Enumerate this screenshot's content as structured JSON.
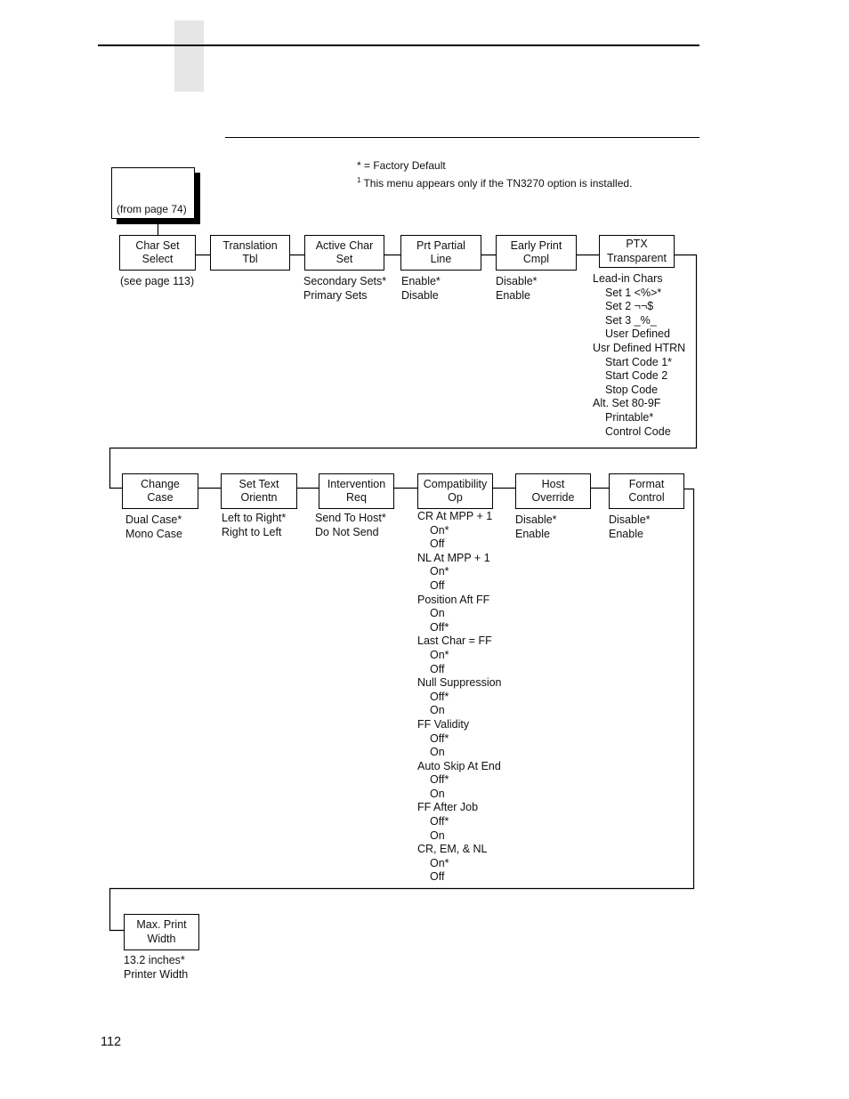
{
  "legend": {
    "default_note": "* = Factory Default",
    "footnote_mark": "1",
    "footnote_text": "This menu appears only if the TN3270 option is installed."
  },
  "entry": {
    "label": "(from page 74)"
  },
  "menus": [
    {
      "id": "char-set-select",
      "title": [
        "Char Set",
        "Select"
      ],
      "options": [
        {
          "label": "(see page 113)",
          "choices": []
        }
      ]
    },
    {
      "id": "translation-tbl",
      "title": [
        "Translation",
        "Tbl"
      ],
      "options": []
    },
    {
      "id": "active-char-set",
      "title": [
        "Active Char",
        "Set"
      ],
      "options": [
        {
          "label": "Secondary Sets*",
          "choices": []
        },
        {
          "label": "Primary Sets",
          "choices": []
        }
      ]
    },
    {
      "id": "prt-partial-line",
      "title": [
        "Prt Partial",
        "Line"
      ],
      "options": [
        {
          "label": "Enable*",
          "choices": []
        },
        {
          "label": "Disable",
          "choices": []
        }
      ]
    },
    {
      "id": "early-print-cmpl",
      "title": [
        "Early Print",
        "Cmpl"
      ],
      "options": [
        {
          "label": "Disable*",
          "choices": []
        },
        {
          "label": "Enable",
          "choices": []
        }
      ]
    },
    {
      "id": "ptx-transparent",
      "title": [
        "PTX",
        "Transparent"
      ],
      "options": [
        {
          "label": "Lead-in Chars",
          "choices": [
            "Set 1 <%>*",
            "Set 2 ¬¬$",
            "Set 3 _%_",
            "User Defined"
          ]
        },
        {
          "label": "Usr Defined HTRN",
          "choices": [
            "Start Code 1*",
            "Start Code 2",
            "Stop Code"
          ]
        },
        {
          "label": "Alt. Set 80-9F",
          "choices": [
            "Printable*",
            "Control Code"
          ]
        }
      ]
    },
    {
      "id": "change-case",
      "title": [
        "Change",
        "Case"
      ],
      "options": [
        {
          "label": "Dual Case*",
          "choices": []
        },
        {
          "label": "Mono Case",
          "choices": []
        }
      ]
    },
    {
      "id": "set-text-orientn",
      "title": [
        "Set Text",
        "Orientn"
      ],
      "options": [
        {
          "label": "Left to Right*",
          "choices": []
        },
        {
          "label": "Right to Left",
          "choices": []
        }
      ]
    },
    {
      "id": "intervention-req",
      "title": [
        "Intervention",
        "Req"
      ],
      "options": [
        {
          "label": "Send To Host*",
          "choices": []
        },
        {
          "label": "Do Not Send",
          "choices": []
        }
      ]
    },
    {
      "id": "compatibility-op",
      "title": [
        "Compatibility",
        "Op"
      ],
      "options": [
        {
          "label": "CR At MPP + 1",
          "choices": [
            "On*",
            "Off"
          ]
        },
        {
          "label": "NL At MPP + 1",
          "choices": [
            "On*",
            "Off"
          ]
        },
        {
          "label": "Position Aft FF",
          "choices": [
            "On",
            "Off*"
          ]
        },
        {
          "label": "Last Char = FF",
          "choices": [
            "On*",
            "Off"
          ]
        },
        {
          "label": "Null Suppression",
          "choices": [
            "Off*",
            "On"
          ]
        },
        {
          "label": "FF Validity",
          "choices": [
            "Off*",
            "On"
          ]
        },
        {
          "label": "Auto Skip At End",
          "choices": [
            "Off*",
            "On"
          ]
        },
        {
          "label": "FF After Job",
          "choices": [
            "Off*",
            "On"
          ]
        },
        {
          "label": "CR, EM, & NL",
          "choices": [
            "On*",
            "Off"
          ]
        }
      ]
    },
    {
      "id": "host-override",
      "title": [
        "Host",
        "Override"
      ],
      "options": [
        {
          "label": "Disable*",
          "choices": []
        },
        {
          "label": "Enable",
          "choices": []
        }
      ]
    },
    {
      "id": "format-control",
      "title": [
        "Format",
        "Control"
      ],
      "options": [
        {
          "label": "Disable*",
          "choices": []
        },
        {
          "label": "Enable",
          "choices": []
        }
      ]
    },
    {
      "id": "max-print-width",
      "title": [
        "Max. Print",
        "Width"
      ],
      "options": [
        {
          "label": "13.2 inches*",
          "choices": []
        },
        {
          "label": "Printer Width",
          "choices": []
        }
      ]
    }
  ],
  "page_number": "112"
}
